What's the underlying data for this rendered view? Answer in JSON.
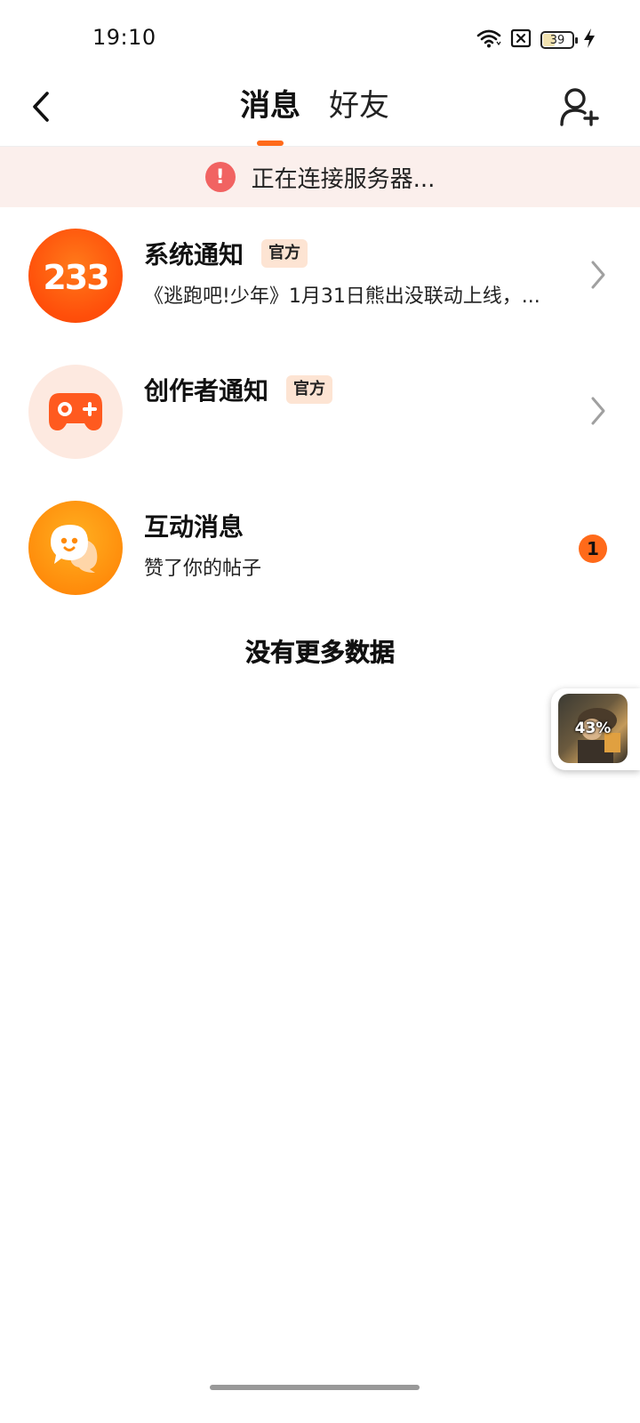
{
  "status_bar": {
    "time": "19:10",
    "battery_level": "39",
    "icons": [
      "wifi-icon",
      "sim-disabled-icon",
      "battery-icon",
      "charging-bolt-icon"
    ]
  },
  "header": {
    "back_icon": "chevron-left-icon",
    "tabs": [
      {
        "label": "消息",
        "active": true
      },
      {
        "label": "好友",
        "active": false
      }
    ],
    "add_friend_icon": "add-user-icon"
  },
  "banner": {
    "icon": "exclamation-icon",
    "text": "正在连接服务器..."
  },
  "messages": [
    {
      "avatar_text": "233",
      "title": "系统通知",
      "badge": "官方",
      "subtitle": "《逃跑吧!少年》1月31日熊出没联动上线，...",
      "trailing": "chevron-right-icon"
    },
    {
      "avatar_icon": "gamepad-icon",
      "title": "创作者通知",
      "badge": "官方",
      "subtitle": "",
      "trailing": "chevron-right-icon"
    },
    {
      "avatar_icon": "chat-bubble-icon",
      "title": "互动消息",
      "subtitle": "赞了你的帖子",
      "unread_count": "1"
    }
  ],
  "list_footer": "没有更多数据",
  "float_widget": {
    "progress_text": "43%"
  },
  "colors": {
    "accent": "#ff6a1a",
    "banner_bg": "#fbefec",
    "banner_icon": "#f16362",
    "badge_bg": "#fde4d3"
  }
}
